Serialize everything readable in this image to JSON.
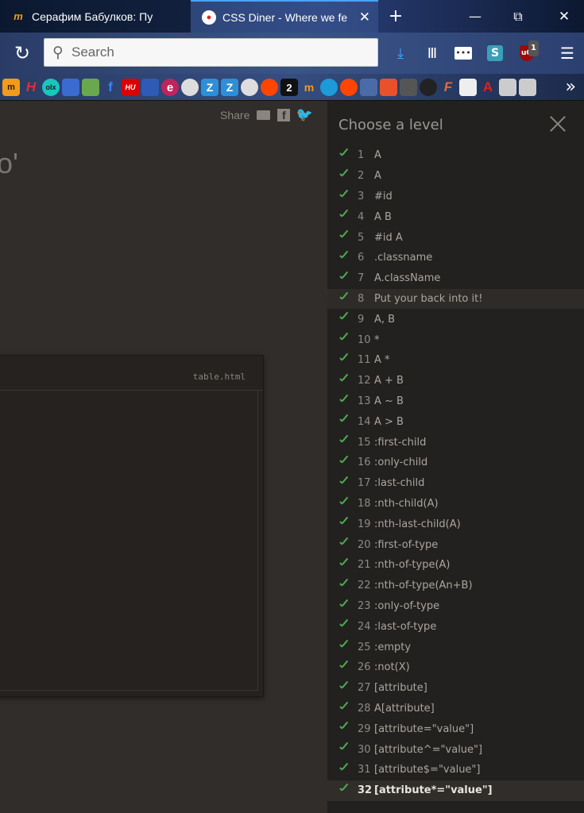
{
  "browser": {
    "tabs": [
      {
        "title": "Серафим Бабулков: Пу",
        "icon": "m-site-icon",
        "active": false
      },
      {
        "title": "CSS Diner - Where we fe",
        "icon": "css-diner-icon",
        "active": true
      }
    ],
    "new_tab": "+",
    "window_controls": {
      "minimize": "—",
      "restore": "⧉",
      "close": "✕"
    },
    "search_placeholder": "Search",
    "extension_badge": "1",
    "bookmarks_more": "»",
    "bookmarks": [
      "m",
      "H",
      "olx",
      "",
      "",
      "f",
      "HU",
      "",
      "e",
      "",
      "Z",
      "Z",
      "",
      "",
      "2",
      "m",
      "",
      "",
      "",
      "",
      "",
      "",
      "F",
      "",
      "A",
      "",
      ""
    ]
  },
  "page": {
    "share_label": "Share",
    "partial_heading": "o'",
    "editor_filename": "table.html"
  },
  "levels": {
    "title": "Choose a level",
    "items": [
      {
        "num": "1",
        "label": "A"
      },
      {
        "num": "2",
        "label": "A"
      },
      {
        "num": "3",
        "label": "#id"
      },
      {
        "num": "4",
        "label": "A  B"
      },
      {
        "num": "5",
        "label": "#id  A"
      },
      {
        "num": "6",
        "label": ".classname"
      },
      {
        "num": "7",
        "label": "A.className"
      },
      {
        "num": "8",
        "label": "Put your back into it!"
      },
      {
        "num": "9",
        "label": "A, B"
      },
      {
        "num": "10",
        "label": "*"
      },
      {
        "num": "11",
        "label": "A  *"
      },
      {
        "num": "12",
        "label": "A + B"
      },
      {
        "num": "13",
        "label": "A ~ B"
      },
      {
        "num": "14",
        "label": "A > B"
      },
      {
        "num": "15",
        "label": ":first-child"
      },
      {
        "num": "16",
        "label": ":only-child"
      },
      {
        "num": "17",
        "label": ":last-child"
      },
      {
        "num": "18",
        "label": ":nth-child(A)"
      },
      {
        "num": "19",
        "label": ":nth-last-child(A)"
      },
      {
        "num": "20",
        "label": ":first-of-type"
      },
      {
        "num": "21",
        "label": ":nth-of-type(A)"
      },
      {
        "num": "22",
        "label": ":nth-of-type(An+B)"
      },
      {
        "num": "23",
        "label": ":only-of-type"
      },
      {
        "num": "24",
        "label": ":last-of-type"
      },
      {
        "num": "25",
        "label": ":empty"
      },
      {
        "num": "26",
        "label": ":not(X)"
      },
      {
        "num": "27",
        "label": "[attribute]"
      },
      {
        "num": "28",
        "label": "A[attribute]"
      },
      {
        "num": "29",
        "label": "[attribute=\"value\"]"
      },
      {
        "num": "30",
        "label": "[attribute^=\"value\"]"
      },
      {
        "num": "31",
        "label": "[attribute$=\"value\"]"
      },
      {
        "num": "32",
        "label": "[attribute*=\"value\"]"
      }
    ],
    "hover_index": 7,
    "current_index": 31
  },
  "colors": {
    "check_green": "#4caf50",
    "panel_bg": "#23211f",
    "page_bg": "#302d2a"
  }
}
